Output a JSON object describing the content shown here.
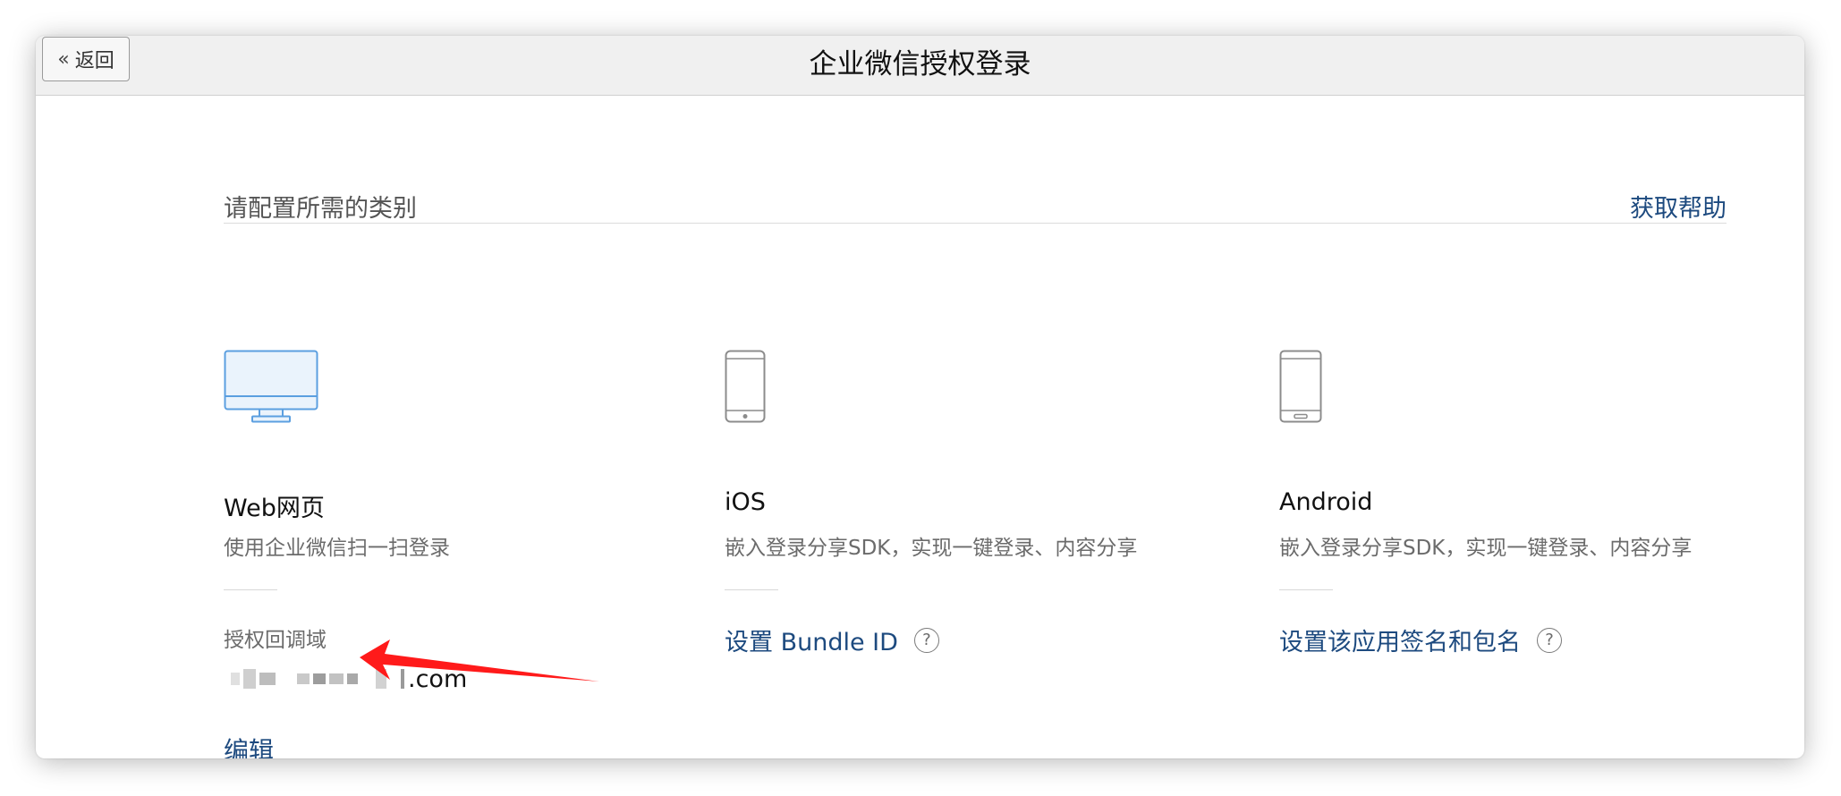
{
  "window": {
    "title": "企业微信授权登录",
    "back_label": "返回"
  },
  "header": {
    "section_label": "请配置所需的类别",
    "help_link": "获取帮助"
  },
  "columns": {
    "web": {
      "title": "Web网页",
      "description": "使用企业微信扫一扫登录",
      "field_label": "授权回调域",
      "domain_suffix": ".com",
      "edit_label": "编辑",
      "icon": "monitor-icon"
    },
    "ios": {
      "title": "iOS",
      "description": "嵌入登录分享SDK，实现一键登录、内容分享",
      "link_label": "设置 Bundle ID",
      "icon": "phone-icon"
    },
    "android": {
      "title": "Android",
      "description": "嵌入登录分享SDK，实现一键登录、内容分享",
      "link_label": "设置该应用签名和包名",
      "icon": "android-phone-icon"
    }
  },
  "colors": {
    "link": "#1d4a7f",
    "monitor_icon": "#5b9fe0",
    "arrow": "#ff1a1a"
  }
}
